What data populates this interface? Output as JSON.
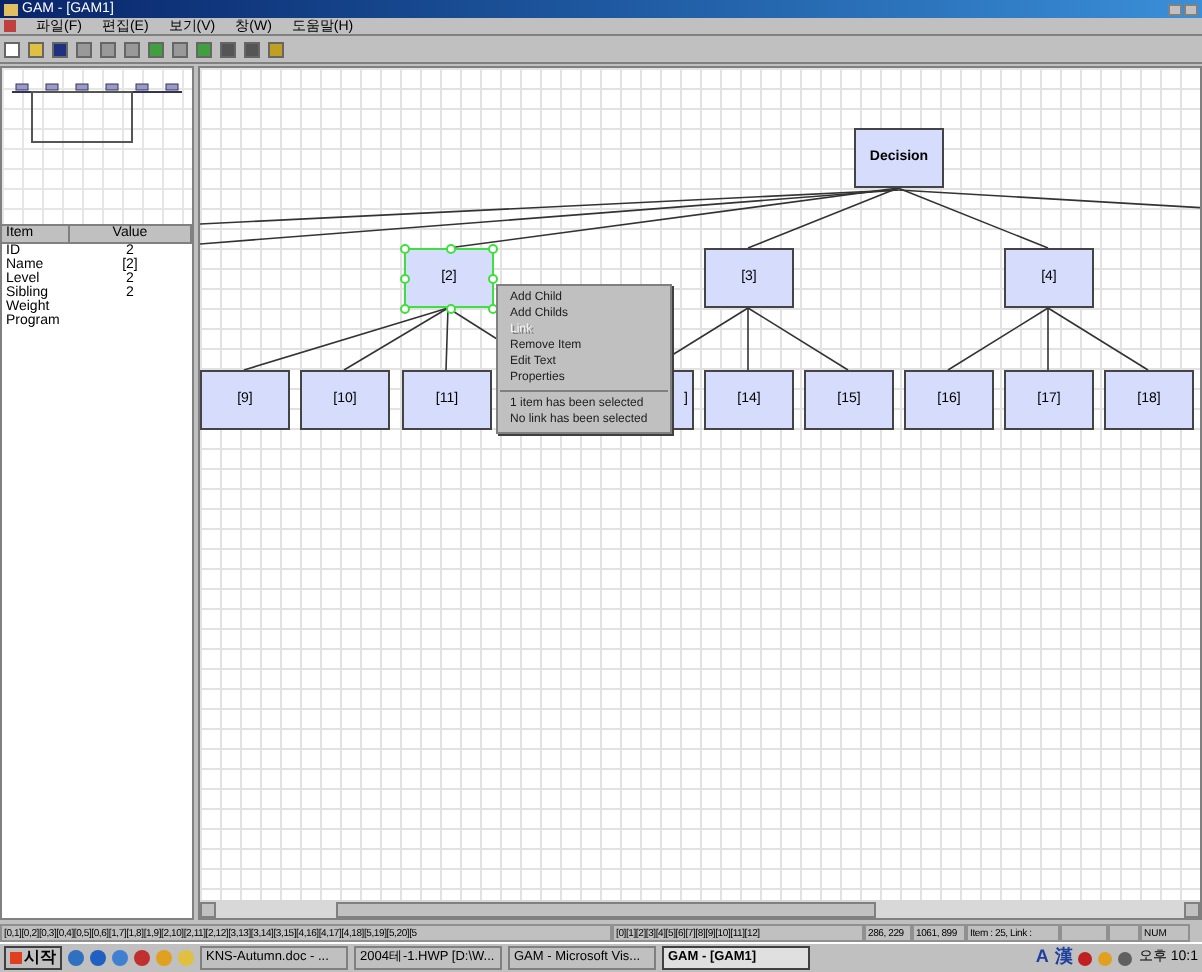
{
  "window": {
    "title": "GAM - [GAM1]"
  },
  "menu": [
    "파일(F)",
    "편집(E)",
    "보기(V)",
    "창(W)",
    "도움말(H)"
  ],
  "properties": {
    "columns": [
      "Item",
      "Value"
    ],
    "rows": [
      {
        "item": "ID",
        "value": "2"
      },
      {
        "item": "Name",
        "value": "[2]"
      },
      {
        "item": "Level",
        "value": "2"
      },
      {
        "item": "Sibling",
        "value": "2"
      },
      {
        "item": "Weight"
      },
      {
        "item": "Program"
      }
    ]
  },
  "nodes": [
    {
      "label": "Decision",
      "kind": "root",
      "selected": false
    },
    {
      "label": "[2]",
      "kind": "node",
      "selected": true
    },
    {
      "label": "[3]",
      "kind": "node",
      "selected": false
    },
    {
      "label": "[4]",
      "kind": "node",
      "selected": false
    },
    {
      "label": "[9]",
      "kind": "node",
      "selected": false
    },
    {
      "label": "[10]",
      "kind": "node",
      "selected": false
    },
    {
      "label": "[11]",
      "kind": "node",
      "selected": false
    },
    {
      "label": "]",
      "kind": "node",
      "selected": false
    },
    {
      "label": "[14]",
      "kind": "node",
      "selected": false
    },
    {
      "label": "[15]",
      "kind": "node",
      "selected": false
    },
    {
      "label": "[16]",
      "kind": "node",
      "selected": false
    },
    {
      "label": "[17]",
      "kind": "node",
      "selected": false
    },
    {
      "label": "[18]",
      "kind": "node",
      "selected": false
    }
  ],
  "context_menu": [
    {
      "label": "Add Child",
      "disabled": false,
      "kind": "item"
    },
    {
      "label": "Add Childs",
      "disabled": false,
      "kind": "item"
    },
    {
      "label": "Link",
      "disabled": true,
      "kind": "item"
    },
    {
      "label": "Remove Item",
      "disabled": false,
      "kind": "item"
    },
    {
      "label": "Edit Text",
      "disabled": false,
      "kind": "item"
    },
    {
      "label": "Properties",
      "disabled": false,
      "kind": "item"
    },
    {
      "kind": "separator"
    },
    {
      "label": "1 item has been selected",
      "disabled": false,
      "kind": "item"
    },
    {
      "label": "No link has been selected",
      "disabled": false,
      "kind": "item"
    }
  ],
  "status_bar": [
    "[0,1][0,2][0,3][0,4][0,5][0,6][1,7][1,8][1,9][2,10][2,11][2,12][3,13][3,14][3,15][4,16][4,17][4,18][5,19][5,20][5",
    "[0][1][2][3][4][5][6][7][8][9][10][11][12]",
    "286, 229",
    "1061, 899",
    "Item : 25, Link :",
    "NUM"
  ],
  "taskbar": {
    "start": "시작",
    "tasks": [
      {
        "label": "KNS-Autumn.doc - ...",
        "selected": false
      },
      {
        "label": "2004테-1.HWP [D:\\W...",
        "selected": false
      },
      {
        "label": "GAM - Microsoft Vis...",
        "selected": false
      },
      {
        "label": "GAM - [GAM1]",
        "selected": true
      }
    ],
    "tray": [
      "A",
      "漢"
    ],
    "clock": "오후 10:1"
  }
}
